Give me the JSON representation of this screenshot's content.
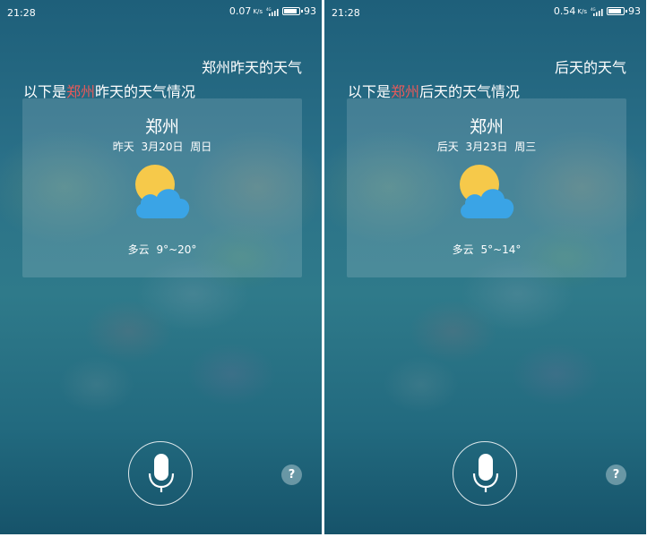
{
  "screens": [
    {
      "status": {
        "time": "21:28",
        "net_speed": "0.07",
        "net_unit": "K/s",
        "network_type": "4G",
        "battery": "93"
      },
      "query": "郑州昨天的天气",
      "response": {
        "prefix": "以下是",
        "city_highlight": "郑州",
        "suffix": "昨天的天气情况"
      },
      "card": {
        "city": "郑州",
        "relative_day": "昨天",
        "date": "3月20日",
        "weekday": "周日",
        "condition": "多云",
        "temp_range": "9°~20°",
        "icon": "partly-cloudy-icon"
      },
      "controls": {
        "mic_icon": "microphone-icon",
        "help_label": "?"
      }
    },
    {
      "status": {
        "time": "21:28",
        "net_speed": "0.54",
        "net_unit": "K/s",
        "network_type": "4G",
        "battery": "93"
      },
      "query": "后天的天气",
      "response": {
        "prefix": "以下是",
        "city_highlight": "郑州",
        "suffix": "后天的天气情况"
      },
      "card": {
        "city": "郑州",
        "relative_day": "后天",
        "date": "3月23日",
        "weekday": "周三",
        "condition": "多云",
        "temp_range": "5°~14°",
        "icon": "partly-cloudy-icon"
      },
      "controls": {
        "mic_icon": "microphone-icon",
        "help_label": "?"
      }
    }
  ],
  "colors": {
    "highlight": "#e85a5a",
    "sun": "#f6c94a",
    "cloud": "#3aa4e6"
  }
}
